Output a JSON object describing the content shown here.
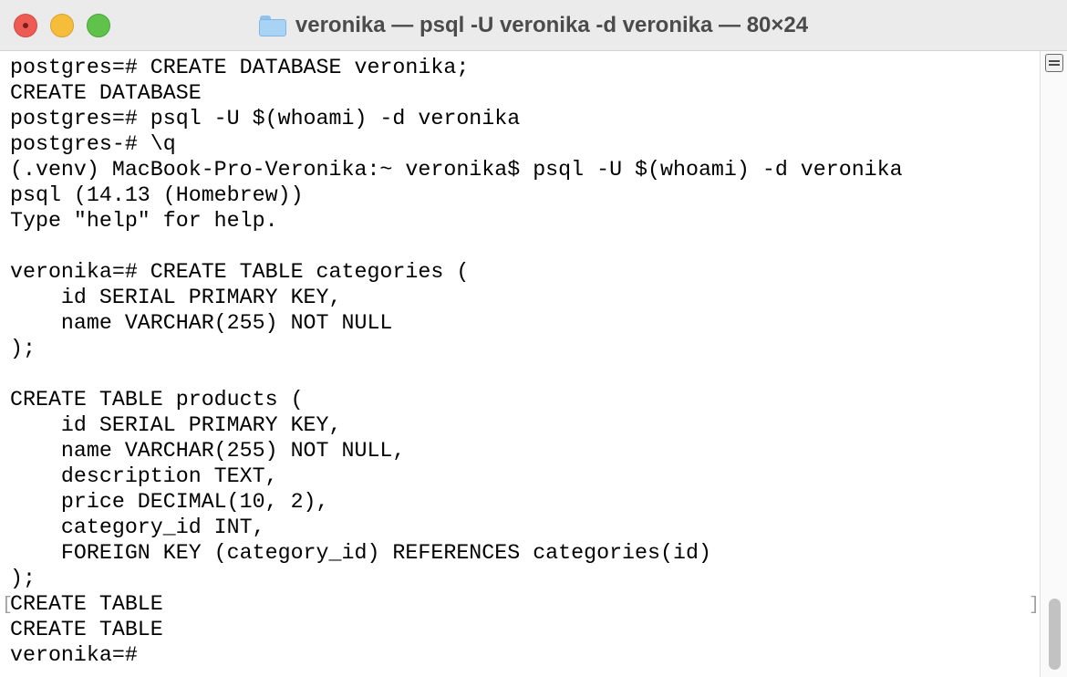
{
  "window": {
    "title": "veronika — psql -U veronika -d veronika — 80×24"
  },
  "terminal": {
    "lines": [
      "postgres=# CREATE DATABASE veronika;",
      "CREATE DATABASE",
      "postgres=# psql -U $(whoami) -d veronika",
      "postgres-# \\q",
      "(.venv) MacBook-Pro-Veronika:~ veronika$ psql -U $(whoami) -d veronika",
      "psql (14.13 (Homebrew))",
      "Type \"help\" for help.",
      "",
      "veronika=# CREATE TABLE categories (",
      "    id SERIAL PRIMARY KEY,",
      "    name VARCHAR(255) NOT NULL",
      ");",
      "",
      "CREATE TABLE products (",
      "    id SERIAL PRIMARY KEY,",
      "    name VARCHAR(255) NOT NULL,",
      "    description TEXT,",
      "    price DECIMAL(10, 2),",
      "    category_id INT,",
      "    FOREIGN KEY (category_id) REFERENCES categories(id)",
      ");",
      "CREATE TABLE",
      "CREATE TABLE",
      "veronika=# "
    ],
    "prompt_bracket_left": "[",
    "prompt_bracket_right": "]"
  },
  "icons": {
    "folder": "folder-icon",
    "split": "split-pane-icon"
  },
  "colors": {
    "close": "#ee5b55",
    "minimize": "#f5bd3a",
    "zoom": "#5fc24a",
    "folder": "#a9d3f5"
  }
}
